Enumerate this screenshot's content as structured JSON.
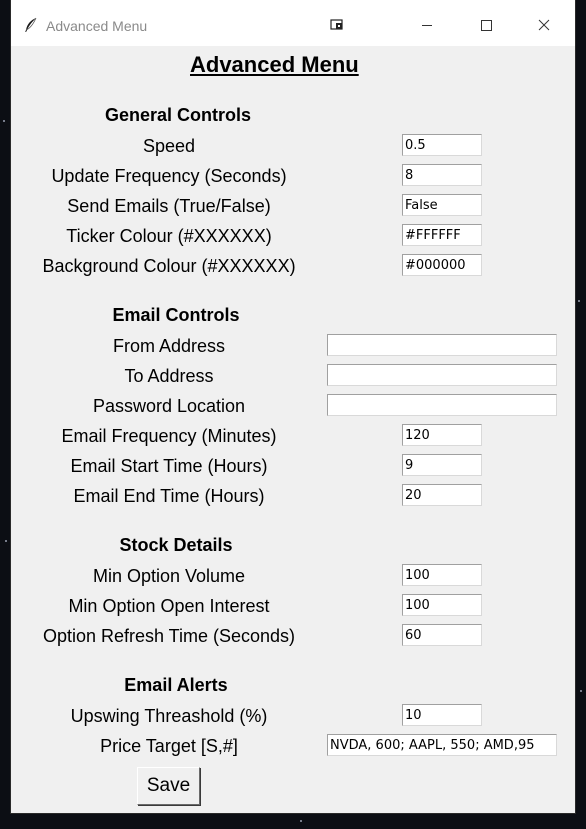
{
  "window": {
    "title": "Advanced Menu"
  },
  "heading": "Advanced Menu",
  "sections": {
    "general": "General Controls",
    "email": "Email Controls",
    "stock": "Stock Details",
    "alerts": "Email Alerts"
  },
  "fields": {
    "speed": {
      "label": "Speed",
      "value": "0.5"
    },
    "update_frequency": {
      "label": "Update Frequency (Seconds)",
      "value": "8"
    },
    "send_emails": {
      "label": "Send Emails (True/False)",
      "value": "False"
    },
    "ticker_colour": {
      "label": "Ticker Colour (#XXXXXX)",
      "value": "#FFFFFF"
    },
    "background_colour": {
      "label": "Background Colour (#XXXXXX)",
      "value": "#000000"
    },
    "from_address": {
      "label": "From Address",
      "value": ""
    },
    "to_address": {
      "label": "To Address",
      "value": ""
    },
    "password_location": {
      "label": "Password Location",
      "value": ""
    },
    "email_frequency": {
      "label": "Email Frequency (Minutes)",
      "value": "120"
    },
    "email_start_time": {
      "label": "Email Start Time (Hours)",
      "value": "9"
    },
    "email_end_time": {
      "label": "Email End Time (Hours)",
      "value": "20"
    },
    "min_option_volume": {
      "label": "Min Option Volume",
      "value": "100"
    },
    "min_option_open_interest": {
      "label": "Min Option Open Interest",
      "value": "100"
    },
    "option_refresh_time": {
      "label": "Option Refresh Time (Seconds)",
      "value": "60"
    },
    "upswing_threshold": {
      "label": "Upswing Threashold (%)",
      "value": "10"
    },
    "price_target": {
      "label": "Price Target [S,#]",
      "value": "NVDA, 600; AAPL, 550; AMD,95"
    }
  },
  "buttons": {
    "save": "Save"
  },
  "icons": {
    "app": "feather-icon",
    "snap": "snap-layout-icon",
    "minimize": "minimize-icon",
    "maximize": "maximize-icon",
    "close": "close-icon"
  }
}
